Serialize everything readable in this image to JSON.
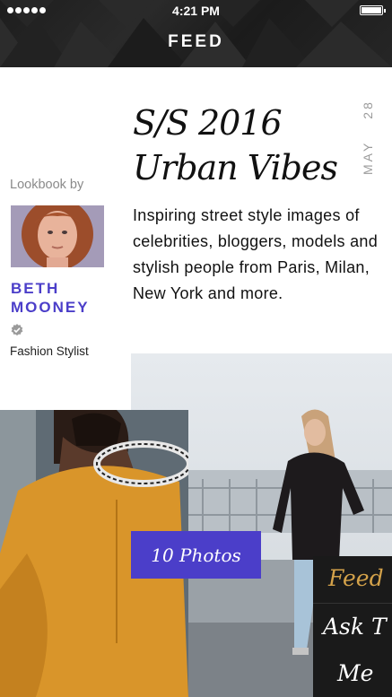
{
  "status_bar": {
    "time": "4:21 PM"
  },
  "header": {
    "title": "FEED"
  },
  "article": {
    "date_month": "MAY",
    "date_day": "28",
    "headline_line1": "S/S 2016",
    "headline_line2": "Urban Vibes",
    "description": "Inspiring street style images of celebrities, bloggers, models and stylish people from Paris, Milan, New York and more."
  },
  "author": {
    "lookbook_label": "Lookbook by",
    "name_line1": "BETH",
    "name_line2": "MOONEY",
    "role": "Fashion Stylist"
  },
  "photos_button": {
    "label": "10 Photos"
  },
  "side_menu": {
    "items": [
      {
        "label": "Feed"
      },
      {
        "label": "Ask T"
      },
      {
        "label": "Me"
      }
    ]
  },
  "colors": {
    "accent": "#4b3ec9",
    "menu_active": "#d4a24a",
    "header_bg": "#1f1f1f"
  }
}
